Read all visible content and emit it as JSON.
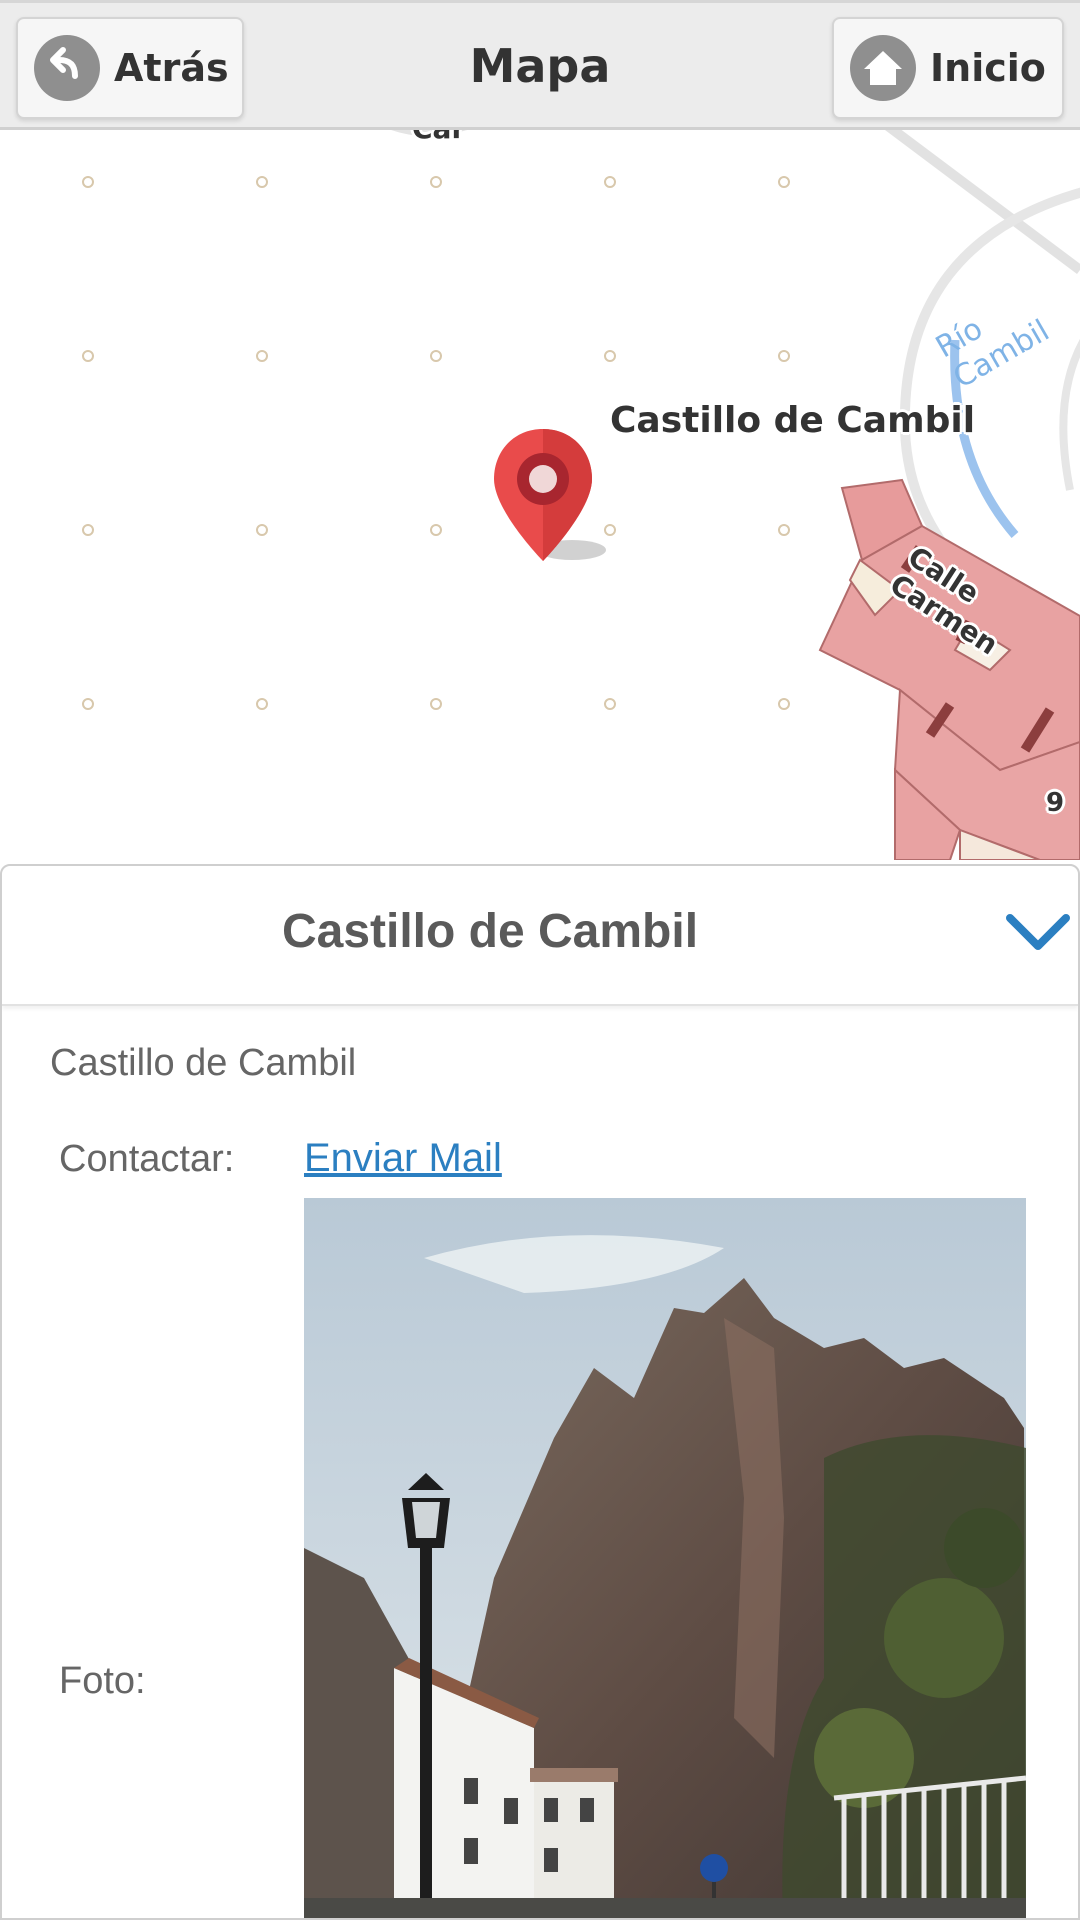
{
  "header": {
    "back_label": "Atrás",
    "title": "Mapa",
    "home_label": "Inicio"
  },
  "map": {
    "place_label": "Castillo de Cambil",
    "street_label": "Calle Carmen",
    "river_label": "Río Cambil",
    "partial_top_label": "Car",
    "building_number": "9",
    "marker_color": "#e94b4b"
  },
  "panel": {
    "title": "Castillo de Cambil",
    "subtitle": "Castillo de Cambil",
    "contact_label": "Contactar:",
    "contact_link": "Enviar Mail",
    "photo_label": "Foto:",
    "accent_color": "#2b7fc1"
  },
  "icons": {
    "back": "back-arrow-icon",
    "home": "home-icon",
    "collapse": "chevron-down-icon",
    "marker": "map-pin-icon"
  }
}
